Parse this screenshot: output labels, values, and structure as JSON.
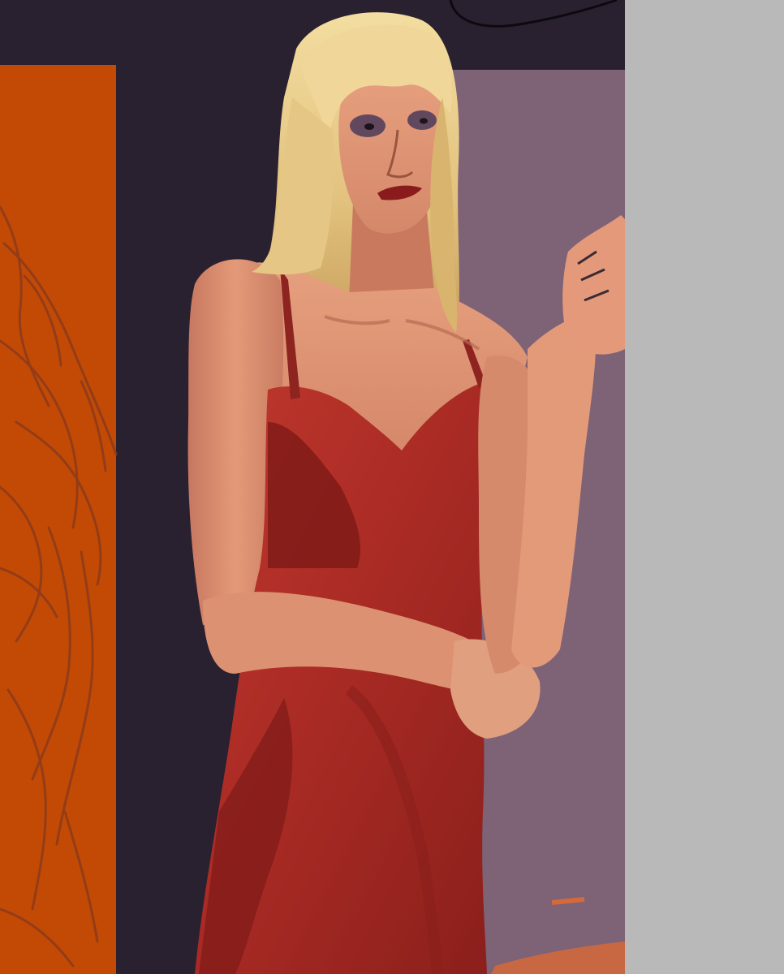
{
  "artwork": {
    "subject": "",
    "palette": {
      "background_dark": "#2a2130",
      "panel_orange": "#c24a05",
      "panel_mauve": "#7e6276",
      "side_panel_grey": "#b9b9b9",
      "sketch_line": "#8a3a1c",
      "hair_blonde": "#e9cf8c",
      "skin": "#d9876a",
      "skin_shadow": "#b86b53",
      "dress_red": "#b4302a",
      "dress_shadow": "#7e1a17",
      "lips": "#8a1b1d",
      "eyeshadow": "#4a3a5a"
    },
    "regions": [
      "orange-panel-with-sketch",
      "dark-background",
      "mauve-panel",
      "grey-side-panel",
      "figure-in-red-dress"
    ]
  }
}
